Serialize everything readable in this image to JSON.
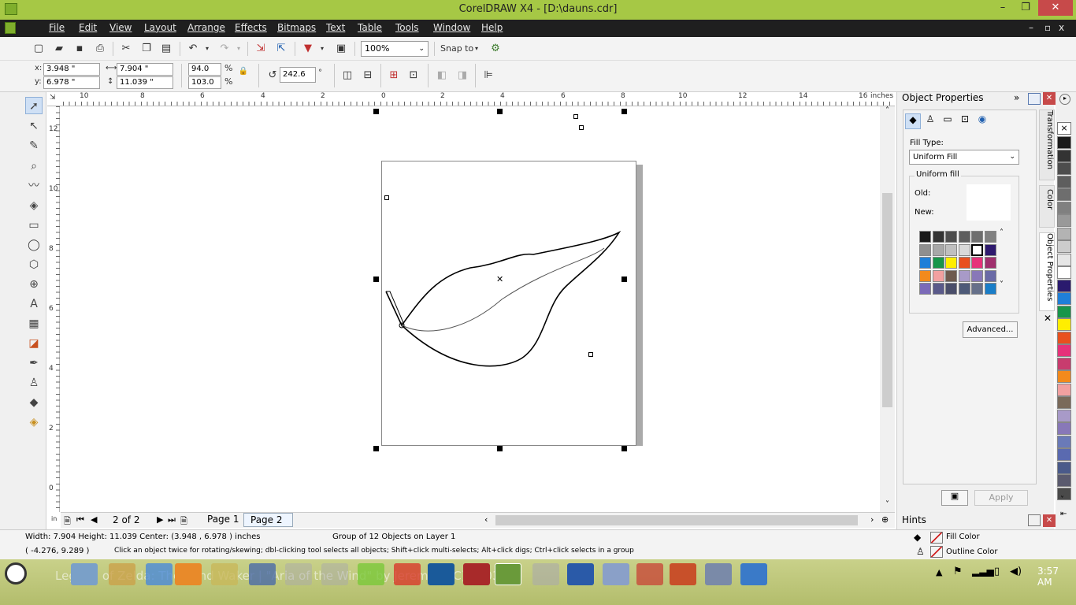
{
  "title_bar": {
    "title": "CorelDRAW X4 - [D:\\dauns.cdr]",
    "minimize": "–",
    "maximize": "❐",
    "close": "✕"
  },
  "menu": {
    "items": [
      "File",
      "Edit",
      "View",
      "Layout",
      "Arrange",
      "Effects",
      "Bitmaps",
      "Text",
      "Table",
      "Tools",
      "Window",
      "Help"
    ],
    "doc_controls": [
      "–",
      "▫",
      "x"
    ]
  },
  "standard_toolbar": {
    "zoom": "100%",
    "snap_to": "Snap to"
  },
  "property_bar": {
    "x": "3.948 \"",
    "y": "6.978 \"",
    "width": "7.904 \"",
    "height": "11.039 \"",
    "scale_x": "94.0",
    "scale_y": "103.0",
    "percent": "%",
    "angle": "242.6",
    "degree": "°"
  },
  "ruler": {
    "h_ticks": [
      "10",
      "8",
      "6",
      "4",
      "2",
      "0",
      "2",
      "4",
      "6",
      "8",
      "10",
      "12",
      "14",
      "16"
    ],
    "unit": "inches",
    "v_ticks": [
      "12",
      "10",
      "8",
      "6",
      "4",
      "2",
      "0"
    ]
  },
  "page_nav": {
    "counter": "2 of 2",
    "tabs": [
      "Page 1",
      "Page 2"
    ]
  },
  "object_properties": {
    "header": "Object Properties",
    "fill_type_label": "Fill Type:",
    "fill_type_value": "Uniform Fill",
    "group_label": "Uniform fill",
    "old_label": "Old:",
    "new_label": "New:",
    "advanced_button": "Advanced...",
    "apply_button": "Apply",
    "side_tabs": [
      "Transformation",
      "Color",
      "Object Properties"
    ],
    "palette_colors": [
      "#1a1a1a",
      "#333333",
      "#4d4d4d",
      "#5e5e5e",
      "#6e6e6e",
      "#808080",
      "#8f8f8f",
      "#a8a8a8",
      "#bfbfbf",
      "#d9d9d9",
      "#ffffff",
      "#2e1a6e",
      "#1f7fd8",
      "#18954a",
      "#ffee00",
      "#e8501e",
      "#e6327a",
      "#a0306e",
      "#f28a1c",
      "#f2a0a0",
      "#6e5a4e",
      "#a89ac8",
      "#8878b8",
      "#6a6aa6",
      "#7b6ab8",
      "#5a5a8a",
      "#4a4e6a",
      "#4e5a78",
      "#66708a",
      "#1a7ec8"
    ]
  },
  "hints": {
    "header": "Hints"
  },
  "color_palette": [
    "#1a1a1a",
    "#333333",
    "#4d4d4d",
    "#5e5e5e",
    "#6e6e6e",
    "#808080",
    "#999999",
    "#b3b3b3",
    "#cccccc",
    "#e6e6e6",
    "#ffffff",
    "#2a1a6e",
    "#1f7fd8",
    "#18954a",
    "#ffee00",
    "#e8501e",
    "#e6327a",
    "#c83c6e",
    "#f28a1c",
    "#f2a0a0",
    "#7a6a5a",
    "#a89ac8",
    "#8878b8",
    "#6a7ab8",
    "#5a6ab0",
    "#4a5a8a",
    "#5a5a6e",
    "#4a4a4a"
  ],
  "status": {
    "line1_dims": "Width: 7.904  Height: 11.039  Center: (3.948 , 6.978 )  inches",
    "line1_obj": "Group of 12 Objects on Layer 1",
    "line2_coords": "( -4.276, 9.289 )",
    "line2_hint": "Click an object twice for rotating/skewing; dbl-clicking tool selects all objects; Shift+click multi-selects; Alt+click digs; Ctrl+click selects in a group",
    "fill_color": "Fill Color",
    "outline_color": "Outline Color"
  },
  "taskbar": {
    "bg_text": "Legend of Zelda: The Wind Waker | \"Aria of the Wind\" by Jeremy... (C) 2003",
    "time": "3:57 AM"
  }
}
